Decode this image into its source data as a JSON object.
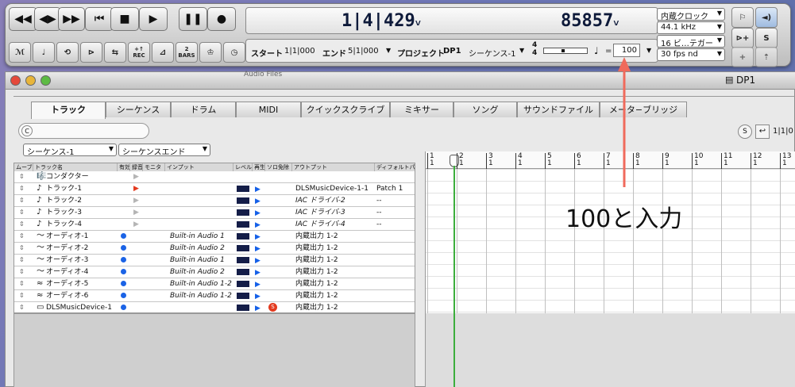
{
  "transport": {
    "location": "1|4|429",
    "location_suffix": "˅",
    "counter": "85857",
    "counter_suffix": "˅",
    "info": {
      "start_label": "スタート",
      "start_value": "1|1|000",
      "end_label": "エンド",
      "end_value": "5|1|000",
      "project_label": "プロジェクト",
      "project_value": "DP1",
      "sequence_value": "シーケンス-1",
      "meter_top": "4",
      "meter_bottom": "4",
      "tempo_equals": "=",
      "tempo_value": "100"
    },
    "clock_source": "内蔵クロック",
    "sample_rate": "44.1 kHz",
    "bit_depth": "16 ビ…テガー",
    "frame_rate": "30 fps nd",
    "two_bars_label": "2",
    "two_bars_sub": "BARS",
    "rec_label": "REC",
    "solo_label": "S"
  },
  "window": {
    "title": "DP1",
    "behind_text": "Audio Files"
  },
  "tabs": [
    "トラック",
    "シーケンス",
    "ドラム",
    "MIDI",
    "クイックスクライブ",
    "ミキサー",
    "ソング",
    "サウンドファイル",
    "メータ−ブリッジ"
  ],
  "active_tab": 0,
  "toolbar": {
    "search_label": "C",
    "sequence_select": "シーケンス-1",
    "sequence_end_select": "シーケンスエンド",
    "s_button": "S",
    "location_field": "1|1|0"
  },
  "table": {
    "headers": [
      "ムーブ",
      "トラック名",
      "有効",
      "録音",
      "モニタ",
      "インプット",
      "レベル",
      "再生",
      "ソロ免除",
      "アウトプット",
      "ディフォルトパ"
    ],
    "rows": [
      {
        "icon": "🎼",
        "name": "コンダクター",
        "enabled": false,
        "rec": "gray",
        "input": "",
        "level": false,
        "play": false,
        "solo": false,
        "output": "",
        "default": ""
      },
      {
        "icon": "♪",
        "name": "トラック-1",
        "enabled": false,
        "rec": "red",
        "input": "",
        "level": true,
        "play": true,
        "solo": false,
        "output": "DLSMusicDevice-1-1",
        "default": "Patch 1"
      },
      {
        "icon": "♪",
        "name": "トラック-2",
        "enabled": false,
        "rec": "gray",
        "input": "",
        "level": true,
        "play": true,
        "solo": false,
        "output": "IAC ドライバ-2",
        "default": "--"
      },
      {
        "icon": "♪",
        "name": "トラック-3",
        "enabled": false,
        "rec": "gray",
        "input": "",
        "level": true,
        "play": true,
        "solo": false,
        "output": "IAC ドライバ-3",
        "default": "--"
      },
      {
        "icon": "♪",
        "name": "トラック-4",
        "enabled": false,
        "rec": "gray",
        "input": "",
        "level": true,
        "play": true,
        "solo": false,
        "output": "IAC ドライバ-4",
        "default": "--"
      },
      {
        "icon": "〜",
        "name": "オーディオ-1",
        "enabled": true,
        "rec": "",
        "input": "Built-in Audio 1",
        "level": true,
        "play": true,
        "solo": false,
        "output": "内蔵出力 1-2",
        "default": ""
      },
      {
        "icon": "〜",
        "name": "オーディオ-2",
        "enabled": true,
        "rec": "",
        "input": "Built-in Audio 2",
        "level": true,
        "play": true,
        "solo": false,
        "output": "内蔵出力 1-2",
        "default": ""
      },
      {
        "icon": "〜",
        "name": "オーディオ-3",
        "enabled": true,
        "rec": "",
        "input": "Built-in Audio 1",
        "level": true,
        "play": true,
        "solo": false,
        "output": "内蔵出力 1-2",
        "default": ""
      },
      {
        "icon": "〜",
        "name": "オーディオ-4",
        "enabled": true,
        "rec": "",
        "input": "Built-in Audio 2",
        "level": true,
        "play": true,
        "solo": false,
        "output": "内蔵出力 1-2",
        "default": ""
      },
      {
        "icon": "≈",
        "name": "オーディオ-5",
        "enabled": true,
        "rec": "",
        "input": "Built-in Audio 1-2",
        "level": true,
        "play": true,
        "solo": false,
        "output": "内蔵出力 1-2",
        "default": ""
      },
      {
        "icon": "≈",
        "name": "オーディオ-6",
        "enabled": true,
        "rec": "",
        "input": "Built-in Audio 1-2",
        "level": true,
        "play": true,
        "solo": false,
        "output": "内蔵出力 1-2",
        "default": ""
      },
      {
        "icon": "▭",
        "name": "DLSMusicDevice-1",
        "enabled": true,
        "rec": "",
        "input": "",
        "level": true,
        "play": true,
        "solo": true,
        "output": "内蔵出力 1-2",
        "default": ""
      }
    ]
  },
  "timeline": {
    "measures": [
      "1",
      "2",
      "3",
      "4",
      "5",
      "6",
      "7",
      "8",
      "9",
      "10",
      "11",
      "12",
      "13"
    ],
    "beat": "1"
  },
  "annotation": {
    "text": "100と入力",
    "color": "#f06a5c"
  },
  "colors": {
    "lcd_text": "#0e1a3a",
    "playhead": "#3cae3c",
    "level": "#141d48",
    "play": "#1560e8",
    "rec_armed": "#e33a1f"
  }
}
